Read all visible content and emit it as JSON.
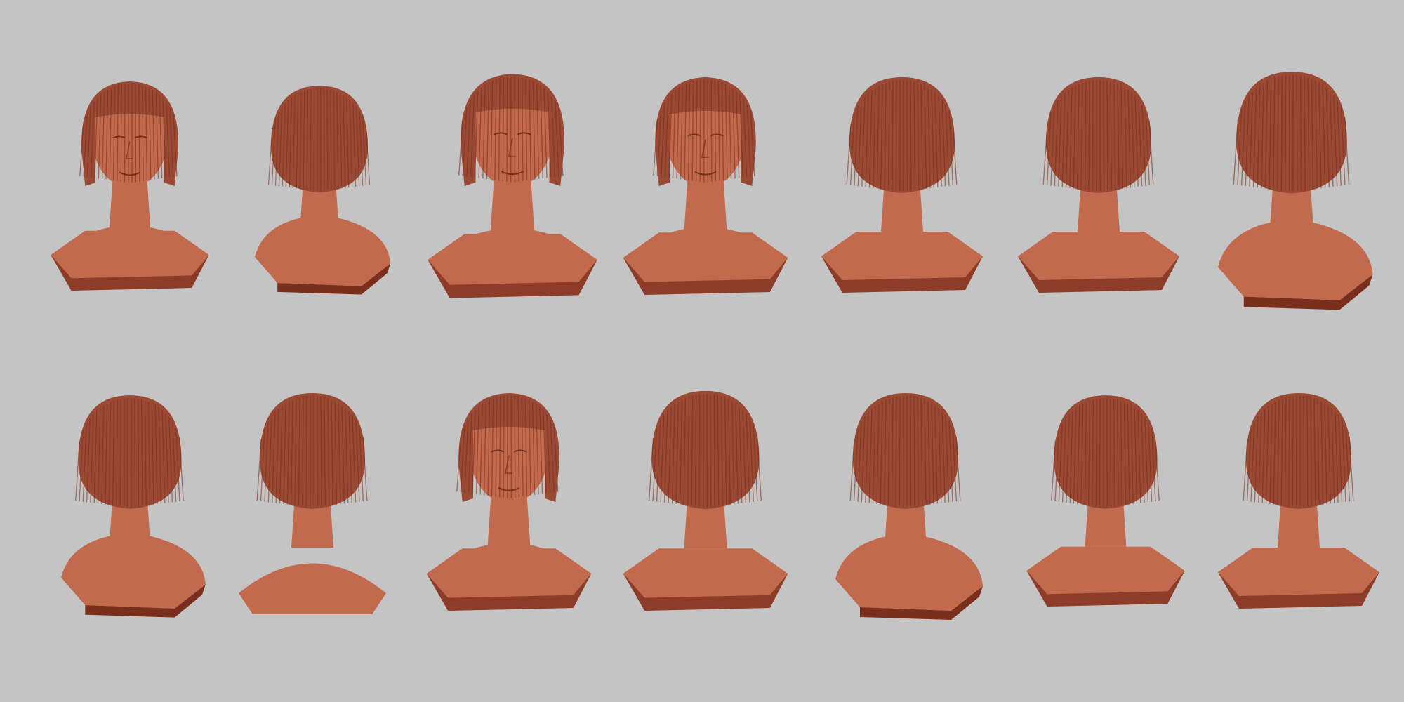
{
  "image": {
    "background": "#c4c4c4",
    "clay_color": "#c26a4e",
    "shadow_color": "#7a2e1c",
    "hair_color": "#9a4a34"
  },
  "rows": [
    {
      "busts": [
        {
          "view": "front",
          "scale": 0.98
        },
        {
          "view": "back-left-three-quarter",
          "scale": 0.92
        },
        {
          "view": "front",
          "scale": 1.05
        },
        {
          "view": "front",
          "scale": 1.02
        },
        {
          "view": "right-profile",
          "scale": 1.0
        },
        {
          "view": "left-three-quarter",
          "scale": 1.0
        },
        {
          "view": "back-right-three-quarter",
          "scale": 1.05
        }
      ]
    },
    {
      "busts": [
        {
          "view": "back-left-three-quarter",
          "scale": 0.98
        },
        {
          "view": "back",
          "scale": 1.0
        },
        {
          "view": "front-looking-down",
          "scale": 1.02
        },
        {
          "view": "top-three-quarter",
          "scale": 1.02
        },
        {
          "view": "right-three-quarter-back",
          "scale": 1.0
        },
        {
          "view": "left-profile-back",
          "scale": 0.98
        },
        {
          "view": "left-profile",
          "scale": 1.0
        }
      ]
    }
  ]
}
